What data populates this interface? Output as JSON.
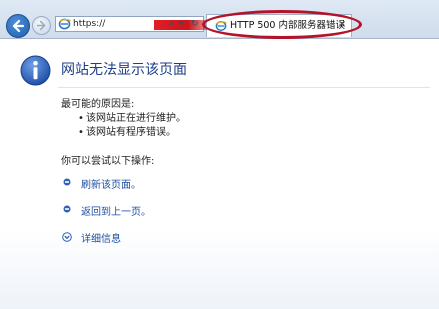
{
  "browser": {
    "address_url": "https://",
    "tab_title": "HTTP 500 内部服务器错误",
    "tab_close": "×",
    "search_glyph": "⌕",
    "refresh_glyph": "↻",
    "dropdown_glyph": "▾",
    "annotation_color": "#b3142b",
    "redaction_color": "#e21f26"
  },
  "page": {
    "title": "网站无法显示该页面",
    "causes_heading": "最可能的原因是:",
    "causes": [
      "该网站正在进行维护。",
      "该网站有程序错误。"
    ],
    "actions_heading": "你可以尝试以下操作:",
    "actions": {
      "refresh": "刷新该页面。",
      "back": "返回到上一页。",
      "details": "详细信息"
    },
    "link_color": "#1f4fa3",
    "title_color": "#1d3f8a"
  }
}
